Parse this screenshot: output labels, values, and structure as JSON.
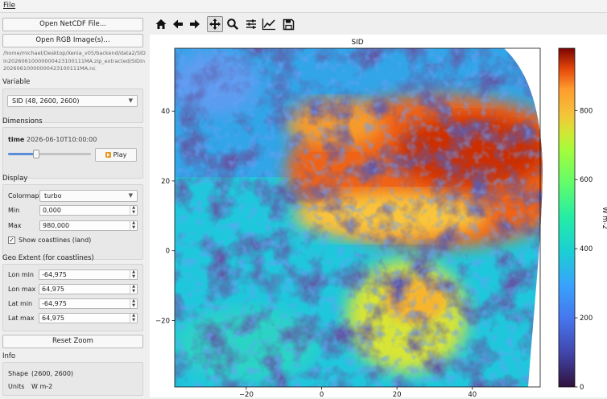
{
  "menubar": {
    "file_label": "File"
  },
  "sidebar": {
    "open_netcdf_label": "Open NetCDF File...",
    "open_rgb_label": "Open RGB Image(s)...",
    "file_path": "/home/michael/Desktop/Xenia_v05/backend/data2/SIDin20260610000000423100111MA.zip_extracted/SIDin20260610000000423100111MA.nc",
    "variable_section": "Variable",
    "variable_value": "SID  (48, 2600, 2600)",
    "dimensions_section": "Dimensions",
    "time_label": "time",
    "time_value": "2026-06-10T10:00:00",
    "time_progress": 0.33,
    "play_label": "Play",
    "display_section": "Display",
    "colormap_label": "Colormap",
    "colormap_value": "turbo",
    "min_label": "Min",
    "min_value": "0,000",
    "max_label": "Max",
    "max_value": "980,000",
    "show_coastlines_label": "Show coastlines (land)",
    "show_coastlines_checked": true,
    "geo_section": "Geo Extent (for coastlines)",
    "lon_min_label": "Lon min",
    "lon_min_value": "-64,975",
    "lon_max_label": "Lon max",
    "lon_max_value": "64,975",
    "lat_min_label": "Lat min",
    "lat_min_value": "-64,975",
    "lat_max_label": "Lat max",
    "lat_max_value": "64,975",
    "reset_zoom_label": "Reset Zoom",
    "info_section": "Info",
    "shape_label": "Shape",
    "shape_value": "(2600, 2600)",
    "units_label": "Units",
    "units_value": "W m-2"
  },
  "toolbar": {
    "icons": [
      "home-icon",
      "back-arrow-icon",
      "forward-arrow-icon",
      "pan-icon",
      "zoom-icon",
      "configure-subplots-icon",
      "edit-axis-icon",
      "save-icon"
    ],
    "active_tool": "pan-icon"
  },
  "colors": {
    "accent": "#5a8ed8",
    "play_icon": "#e8961e"
  },
  "chart_data": {
    "type": "heatmap",
    "title": "SID",
    "xlabel": "",
    "ylabel": "",
    "x_ticks": [
      "−20",
      "0",
      "20",
      "40"
    ],
    "y_ticks": [
      "40",
      "20",
      "0",
      "−20"
    ],
    "x_tick_values": [
      -20,
      0,
      20,
      40
    ],
    "y_tick_values": [
      40,
      20,
      0,
      -20
    ],
    "xlim": [
      -39,
      58
    ],
    "ylim": [
      -39,
      58
    ],
    "colormap": "turbo",
    "colorbar_label": "W m-2",
    "colorbar_ticks": [
      "0",
      "200",
      "400",
      "600",
      "800"
    ],
    "colorbar_tick_values": [
      0,
      200,
      400,
      600,
      800
    ],
    "vmin": 0,
    "vmax": 980
  }
}
